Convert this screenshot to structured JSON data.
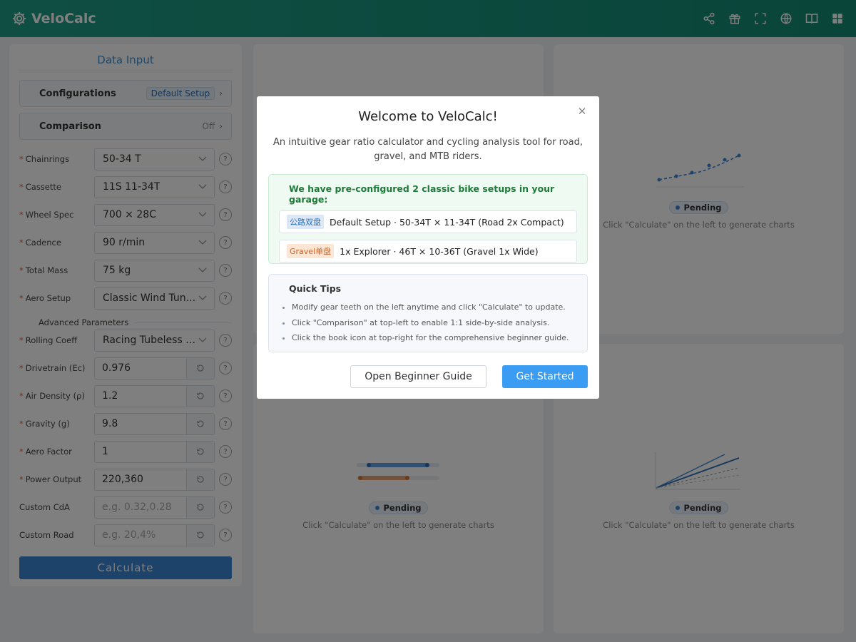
{
  "app": {
    "title": "VeloCalc"
  },
  "header": {
    "icons": [
      "share-icon",
      "gift-icon",
      "fullscreen-icon",
      "globe-icon",
      "book-icon",
      "grid-icon"
    ]
  },
  "sidebar": {
    "title": "Data Input",
    "configurations": {
      "label": "Configurations",
      "value": "Default Setup"
    },
    "comparison": {
      "label": "Comparison",
      "value": "Off"
    },
    "fields": [
      {
        "label": "Chainrings",
        "value": "50-34 T"
      },
      {
        "label": "Cassette",
        "value": "11S 11-34T"
      },
      {
        "label": "Wheel Spec",
        "value": "700 × 28C"
      },
      {
        "label": "Cadence",
        "value": "90 r/min"
      },
      {
        "label": "Total Mass",
        "value": "75 kg"
      },
      {
        "label": "Aero Setup",
        "value": "Classic Wind Tun..."
      }
    ],
    "advanced_title": "Advanced Parameters",
    "rolling": {
      "label": "Rolling Coeff",
      "value": "Racing Tubeless /..."
    },
    "inputs": [
      {
        "label": "Drivetrain (Ec)",
        "value": "0.976",
        "placeholder": ""
      },
      {
        "label": "Air Density (ρ)",
        "value": "1.2",
        "placeholder": ""
      },
      {
        "label": "Gravity (g)",
        "value": "9.8",
        "placeholder": ""
      },
      {
        "label": "Aero Factor",
        "value": "1",
        "placeholder": ""
      },
      {
        "label": "Power Output",
        "value": "220,360",
        "placeholder": ""
      },
      {
        "label": "Custom CdA",
        "value": "",
        "placeholder": "e.g. 0.32,0.28"
      },
      {
        "label": "Custom Road",
        "value": "",
        "placeholder": "e.g. 20,4%"
      }
    ],
    "calculate": "Calculate"
  },
  "panels": {
    "pending_label": "Pending",
    "hint": "Click \"Calculate\" on the left to generate charts"
  },
  "modal": {
    "title": "Welcome to VeloCalc!",
    "description": "An intuitive gear ratio calculator and cycling analysis tool for road, gravel, and MTB riders.",
    "garage_heading": "We have pre-configured 2 classic bike setups in your garage:",
    "setups": [
      {
        "tag": "公路双盘",
        "text": "Default Setup · 50-34T × 11-34T (Road 2x Compact)"
      },
      {
        "tag": "Gravel单盘",
        "text": "1x Explorer · 46T × 10-36T (Gravel 1x Wide)"
      }
    ],
    "tips_heading": "Quick Tips",
    "tips": [
      "Modify gear teeth on the left anytime and click \"Calculate\" to update.",
      "Click \"Comparison\" at top-left to enable 1:1 side-by-side analysis.",
      "Click the book icon at top-right for the comprehensive beginner guide."
    ],
    "guide_button": "Open Beginner Guide",
    "start_button": "Get Started"
  },
  "colors": {
    "header": "#1f9d86",
    "accent": "#3a86d6",
    "primary_button": "#3a9cf2"
  }
}
